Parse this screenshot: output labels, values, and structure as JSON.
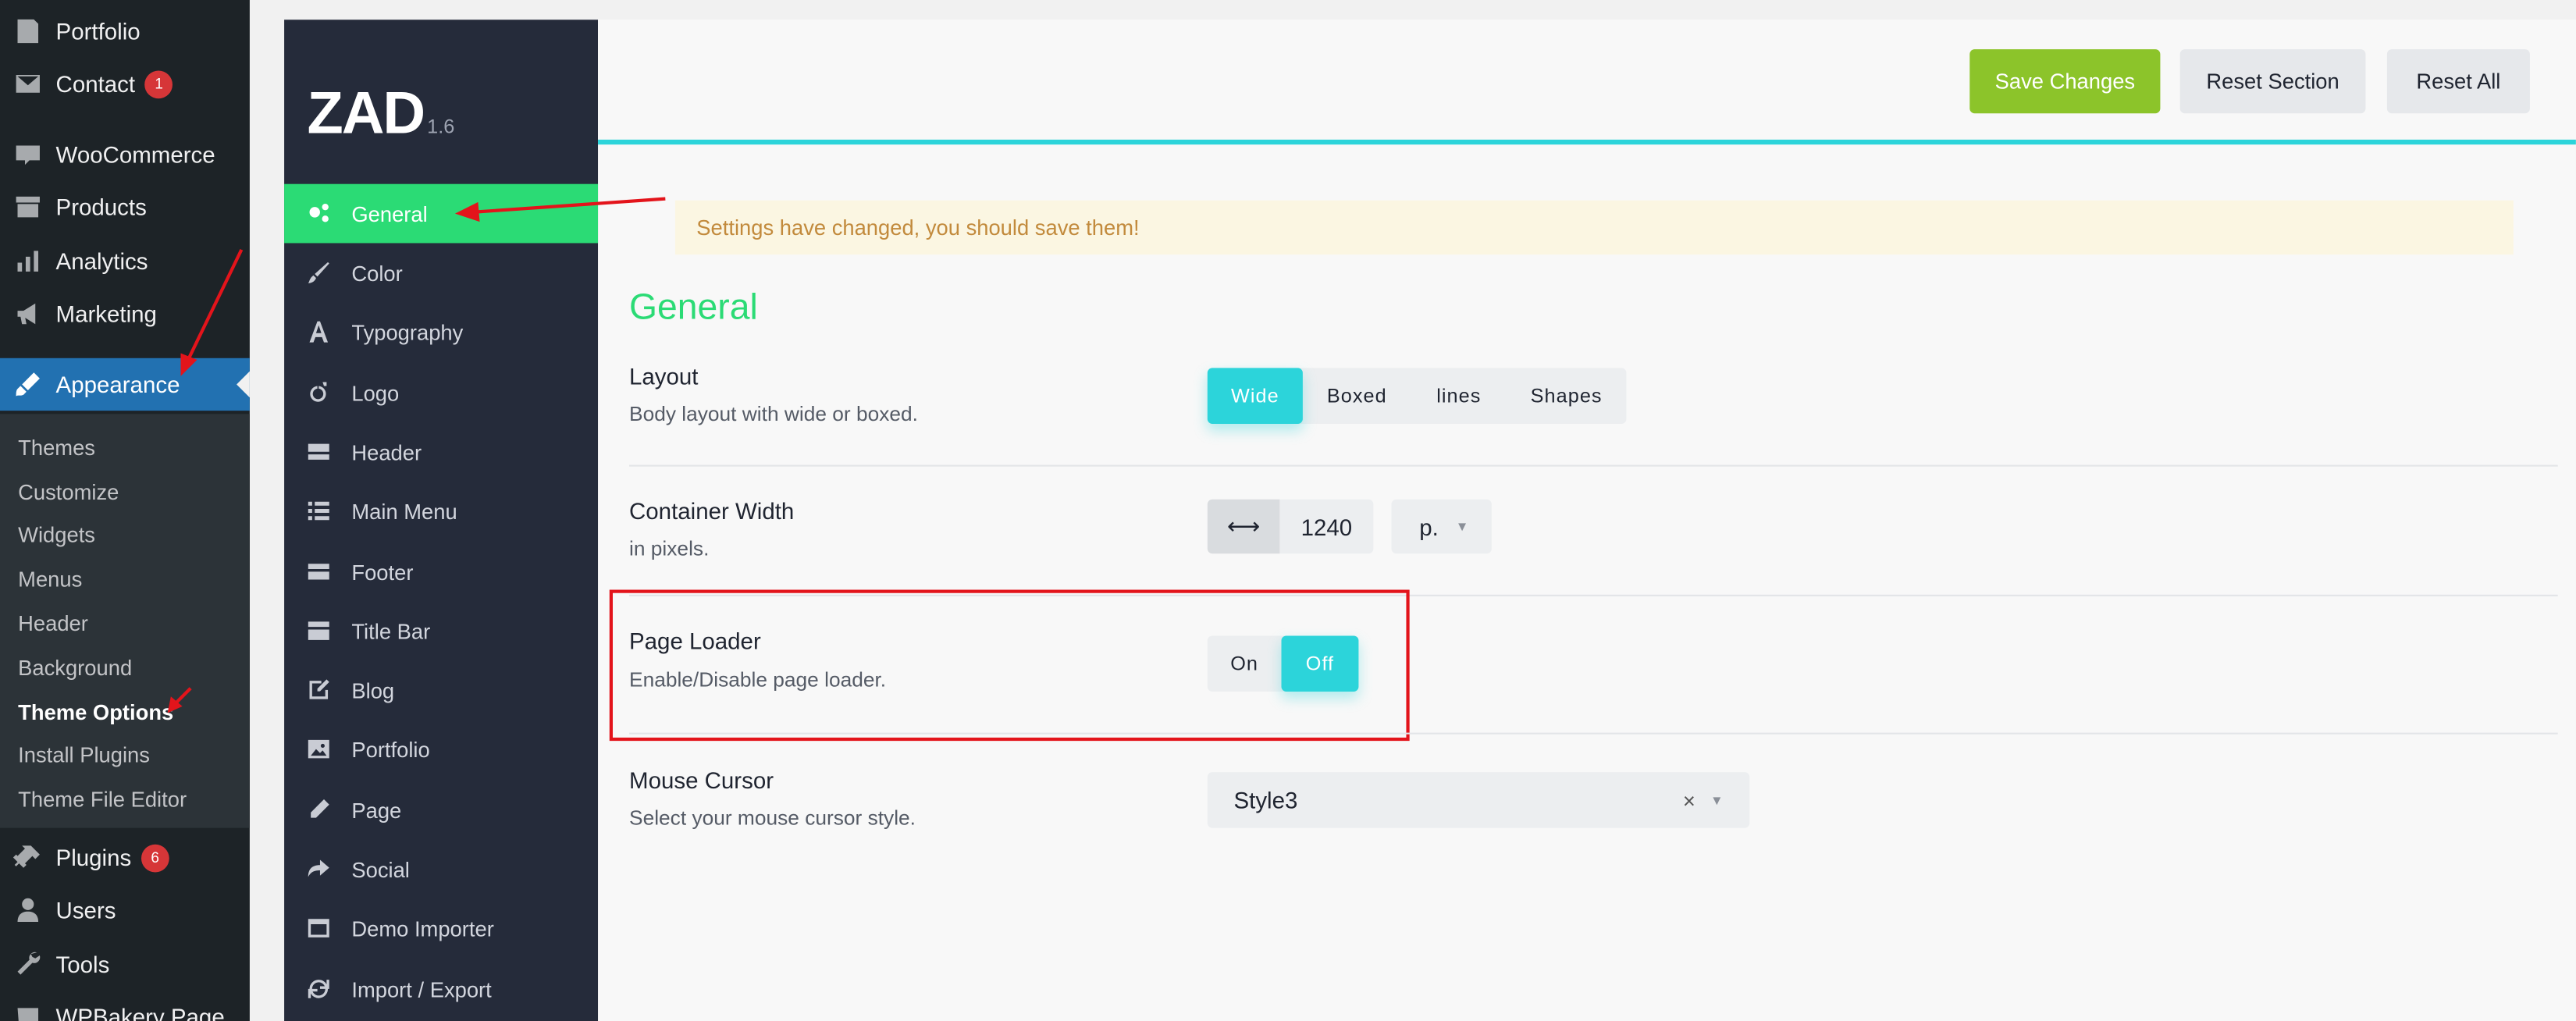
{
  "wp_menu": {
    "items": [
      {
        "label": "Portfolio",
        "icon": "portfolio-icon"
      },
      {
        "label": "Contact",
        "icon": "mail-icon",
        "badge": "1"
      },
      {
        "label": "WooCommerce",
        "icon": "woocommerce-icon"
      },
      {
        "label": "Products",
        "icon": "archive-icon"
      },
      {
        "label": "Analytics",
        "icon": "bar-chart-icon"
      },
      {
        "label": "Marketing",
        "icon": "megaphone-icon"
      },
      {
        "label": "Appearance",
        "icon": "paintbrush-icon",
        "active": true
      },
      {
        "label": "Plugins",
        "icon": "plugin-icon",
        "badge": "6"
      },
      {
        "label": "Users",
        "icon": "user-icon"
      },
      {
        "label": "Tools",
        "icon": "wrench-icon"
      },
      {
        "label": "WPBakery Page",
        "icon": "wpbakery-icon"
      }
    ],
    "appearance_submenu": [
      "Themes",
      "Customize",
      "Widgets",
      "Menus",
      "Header",
      "Background",
      "Theme Options",
      "Install Plugins",
      "Theme File Editor"
    ],
    "current_submenu": "Theme Options"
  },
  "theme_panel": {
    "logo": "ZAD",
    "version": "1.6",
    "nav": [
      {
        "label": "General",
        "icon": "gears-icon",
        "active": true
      },
      {
        "label": "Color",
        "icon": "brush-icon"
      },
      {
        "label": "Typography",
        "icon": "font-icon"
      },
      {
        "label": "Logo",
        "icon": "logo-icon"
      },
      {
        "label": "Header",
        "icon": "header-icon"
      },
      {
        "label": "Main Menu",
        "icon": "list-icon"
      },
      {
        "label": "Footer",
        "icon": "footer-icon"
      },
      {
        "label": "Title Bar",
        "icon": "titlebar-icon"
      },
      {
        "label": "Blog",
        "icon": "edit-icon"
      },
      {
        "label": "Portfolio",
        "icon": "image-icon"
      },
      {
        "label": "Page",
        "icon": "pencil-icon"
      },
      {
        "label": "Social",
        "icon": "share-icon"
      },
      {
        "label": "Demo Importer",
        "icon": "window-icon"
      },
      {
        "label": "Import / Export",
        "icon": "refresh-icon"
      }
    ]
  },
  "toolbar": {
    "save_label": "Save Changes",
    "reset_section_label": "Reset Section",
    "reset_all_label": "Reset All",
    "save_color": "#8cc42a"
  },
  "notice": "Settings have changed, you should save them!",
  "section_title": "General",
  "fields": {
    "layout": {
      "label": "Layout",
      "desc": "Body layout with wide or boxed.",
      "options": [
        "Wide",
        "Boxed",
        "lines",
        "Shapes"
      ],
      "selected": "Wide"
    },
    "container_width": {
      "label": "Container Width",
      "desc": "in pixels.",
      "icon_glyph": "⟷",
      "value": "1240",
      "unit": "p."
    },
    "page_loader": {
      "label": "Page Loader",
      "desc": "Enable/Disable page loader.",
      "on_label": "On",
      "off_label": "Off",
      "selected": "Off"
    },
    "mouse_cursor": {
      "label": "Mouse Cursor",
      "desc": "Select your mouse cursor style.",
      "value": "Style3",
      "clear_glyph": "×",
      "caret_glyph": "▼"
    }
  },
  "colors": {
    "accent": "#2cd4da",
    "active_nav": "#2bdb75",
    "highlight_box": "#e3141b"
  }
}
